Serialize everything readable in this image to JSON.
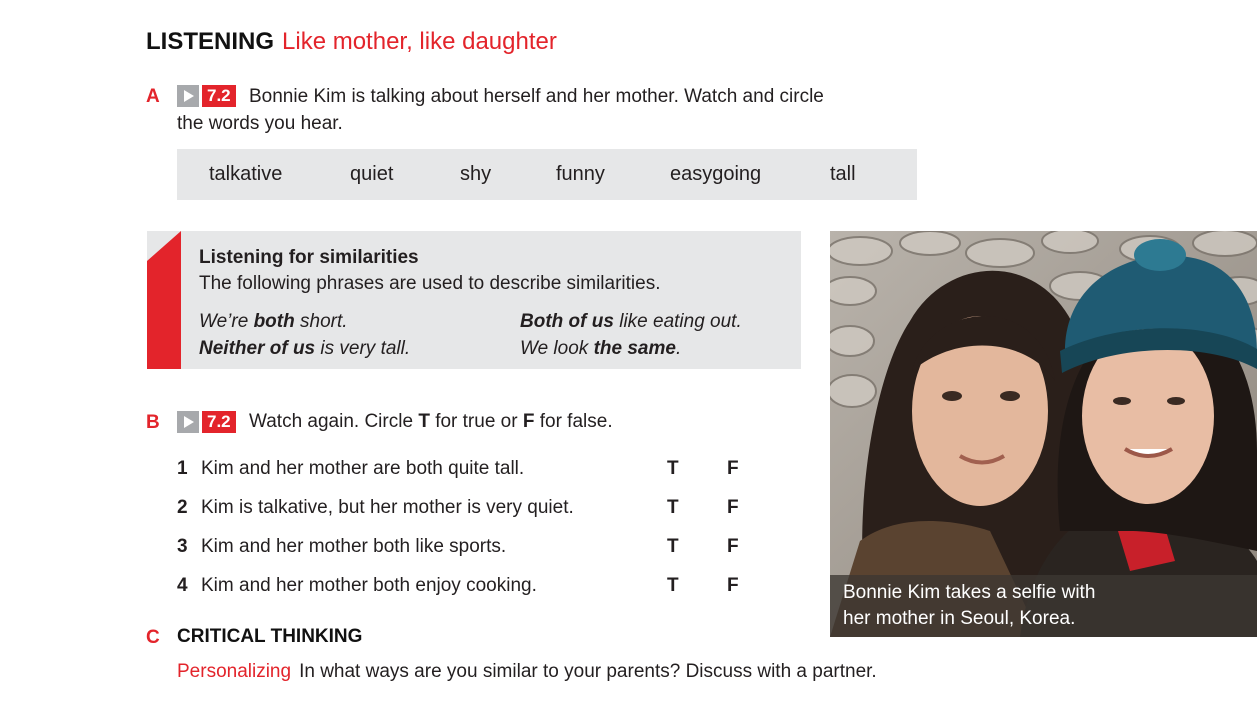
{
  "header": {
    "section": "LISTENING",
    "topic": "Like mother, like daughter"
  },
  "part_a": {
    "letter": "A",
    "video": "7.2",
    "instruction_line1": "Bonnie Kim is talking about herself and her mother. Watch and circle",
    "instruction_line2": "the words you hear.",
    "words": [
      "talkative",
      "quiet",
      "shy",
      "funny",
      "easygoing",
      "tall"
    ]
  },
  "tip": {
    "title": "Listening for similarities",
    "subtitle": "The following phrases are used to describe similarities.",
    "phrases": [
      {
        "before": "We’re ",
        "bold": "both",
        "after": " short."
      },
      {
        "before": "",
        "bold": "Both of us",
        "after": " like eating out."
      },
      {
        "before": "",
        "bold": "Neither of us",
        "after": " is very tall."
      },
      {
        "before": "We look ",
        "bold": "the same",
        "after": "."
      }
    ]
  },
  "part_b": {
    "letter": "B",
    "video": "7.2",
    "instr_a": "Watch again. Circle ",
    "instr_t": "T",
    "instr_b": " for true or ",
    "instr_f": "F",
    "instr_c": " for false.",
    "true_label": "T",
    "false_label": "F",
    "items": [
      {
        "num": "1",
        "text": "Kim and her mother are both quite tall."
      },
      {
        "num": "2",
        "text": "Kim is talkative, but her mother is very quiet."
      },
      {
        "num": "3",
        "text": "Kim and her mother both like sports."
      },
      {
        "num": "4",
        "text": "Kim and her mother both enjoy cooking."
      }
    ]
  },
  "part_c": {
    "letter": "C",
    "title": "CRITICAL THINKING",
    "label": "Personalizing",
    "question": "In what ways are you similar to your parents? Discuss with a partner."
  },
  "photo": {
    "caption_line1": "Bonnie Kim takes a selfie with",
    "caption_line2": "her mother in Seoul, Korea."
  }
}
